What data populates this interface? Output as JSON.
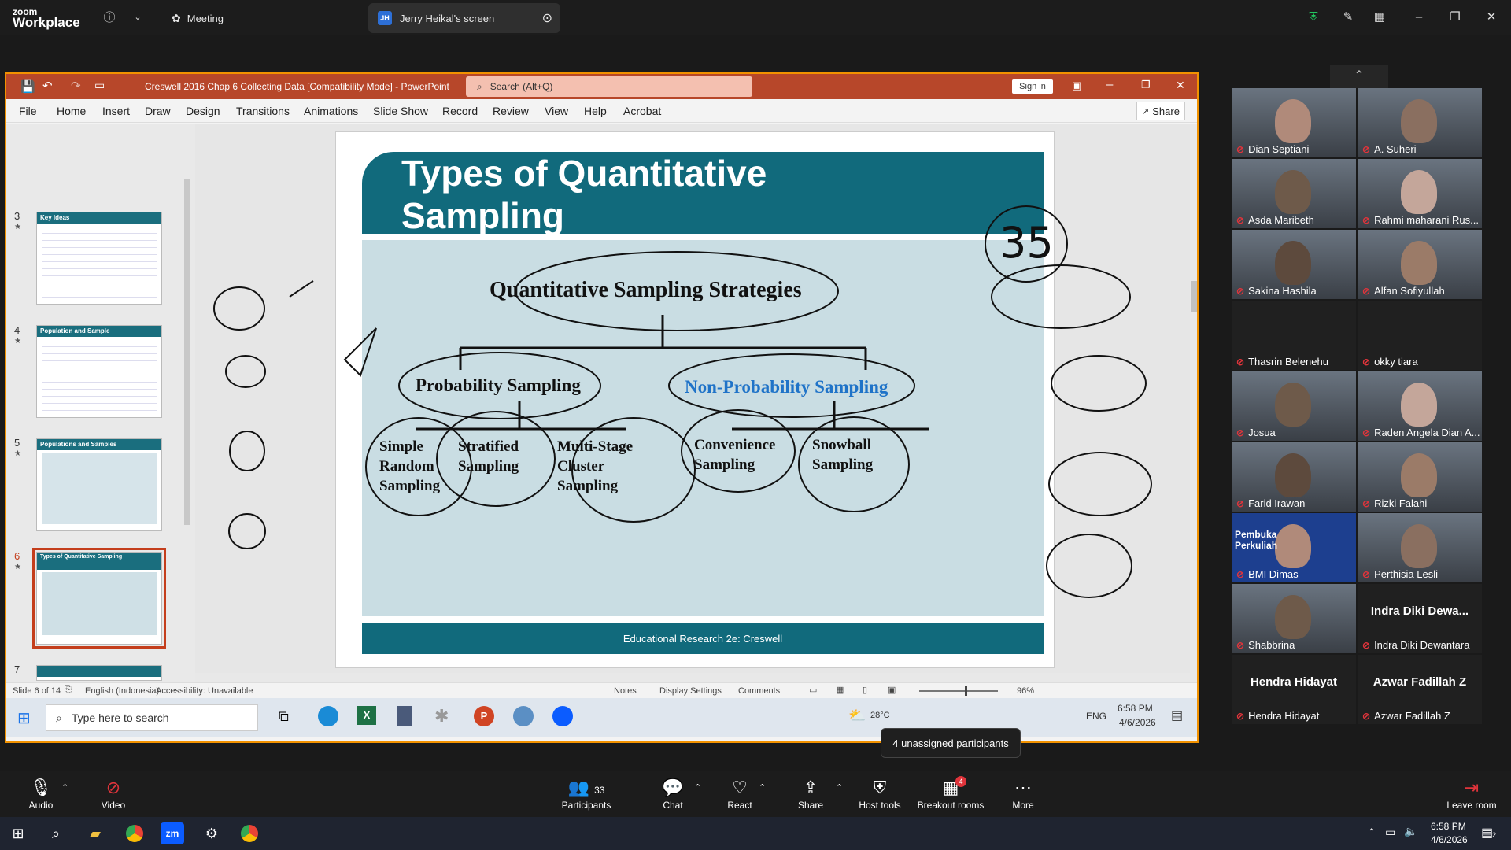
{
  "zoom": {
    "brand_small": "zoom",
    "brand_big": "Workplace",
    "tab_meeting": "Meeting",
    "tab_screen_initials": "JH",
    "tab_screen": "Jerry Heikal's screen",
    "tooltip": "4 unassigned participants",
    "toolbar": {
      "audio": "Audio",
      "video": "Video",
      "participants": "Participants",
      "participants_count": "33",
      "chat": "Chat",
      "react": "React",
      "share": "Share",
      "host_tools": "Host tools",
      "breakout_rooms": "Breakout rooms",
      "breakout_badge": "4",
      "more": "More",
      "leave_room": "Leave room"
    }
  },
  "participants": [
    {
      "name": "Dian Septiani"
    },
    {
      "name": "A. Suheri"
    },
    {
      "name": "Asda Maribeth"
    },
    {
      "name": "Rahmi maharani Rus..."
    },
    {
      "name": "Sakina Hashila"
    },
    {
      "name": "Alfan Sofiyullah"
    },
    {
      "name": "Thasrin Belenehu"
    },
    {
      "name": "okky tiara"
    },
    {
      "name": "Josua"
    },
    {
      "name": "Raden Angela Dian A..."
    },
    {
      "name": "Farid Irawan"
    },
    {
      "name": "Rizki Falahi"
    },
    {
      "name": "BMI Dimas",
      "overlay": "Pembuka Perkuliah"
    },
    {
      "name": "Perthisia Lesli"
    },
    {
      "name": "Shabbrina"
    },
    {
      "name": "Indra Diki Dewantara",
      "big": "Indra Diki Dewa..."
    },
    {
      "name": "Hendra Hidayat",
      "big": "Hendra Hidayat"
    },
    {
      "name": "Azwar Fadillah Z",
      "big": "Azwar Fadillah Z"
    }
  ],
  "ppt": {
    "title": "Creswell 2016 Chap 6 Collecting Data [Compatibility Mode]  -  PowerPoint",
    "search_placeholder": "Search (Alt+Q)",
    "sign_in": "Sign in",
    "share": "Share",
    "menu": [
      "File",
      "Home",
      "Insert",
      "Draw",
      "Design",
      "Transitions",
      "Animations",
      "Slide Show",
      "Record",
      "Review",
      "View",
      "Help",
      "Acrobat"
    ],
    "thumbs": [
      {
        "num": "3",
        "title": "Key Ideas"
      },
      {
        "num": "4",
        "title": "Population and Sample"
      },
      {
        "num": "5",
        "title": "Populations and Samples"
      },
      {
        "num": "6",
        "title": "Types of Quantitative Sampling"
      },
      {
        "num": "7",
        "title": ""
      }
    ],
    "slide": {
      "title_line1": "Types of Quantitative",
      "title_line2": "Sampling",
      "strategies": "Quantitative Sampling Strategies",
      "probability": "Probability Sampling",
      "non_probability": "Non-Probability Sampling",
      "simple_random": [
        "Simple",
        "Random",
        "Sampling"
      ],
      "stratified": [
        "Stratified",
        "Sampling"
      ],
      "multi_stage": [
        "Multi-Stage",
        "Cluster",
        "Sampling"
      ],
      "convenience": [
        "Convenience",
        "Sampling"
      ],
      "snowball": [
        "Snowball",
        "Sampling"
      ],
      "footer": "Educational Research 2e:  Creswell",
      "ink_35": "35"
    },
    "status": {
      "slide": "Slide 6 of 14",
      "language": "English (Indonesia)",
      "accessibility": "Accessibility: Unavailable",
      "notes": "Notes",
      "display_settings": "Display Settings",
      "comments": "Comments",
      "zoom": "96%"
    },
    "inner_taskbar": {
      "search_placeholder": "Type here to search",
      "lang": "ENG",
      "time": "6:58 PM",
      "date": "4/6/2026",
      "weather": "28°C"
    }
  },
  "taskbar": {
    "time": "6:58 PM",
    "date": "4/6/2026",
    "notif_count": "2"
  }
}
